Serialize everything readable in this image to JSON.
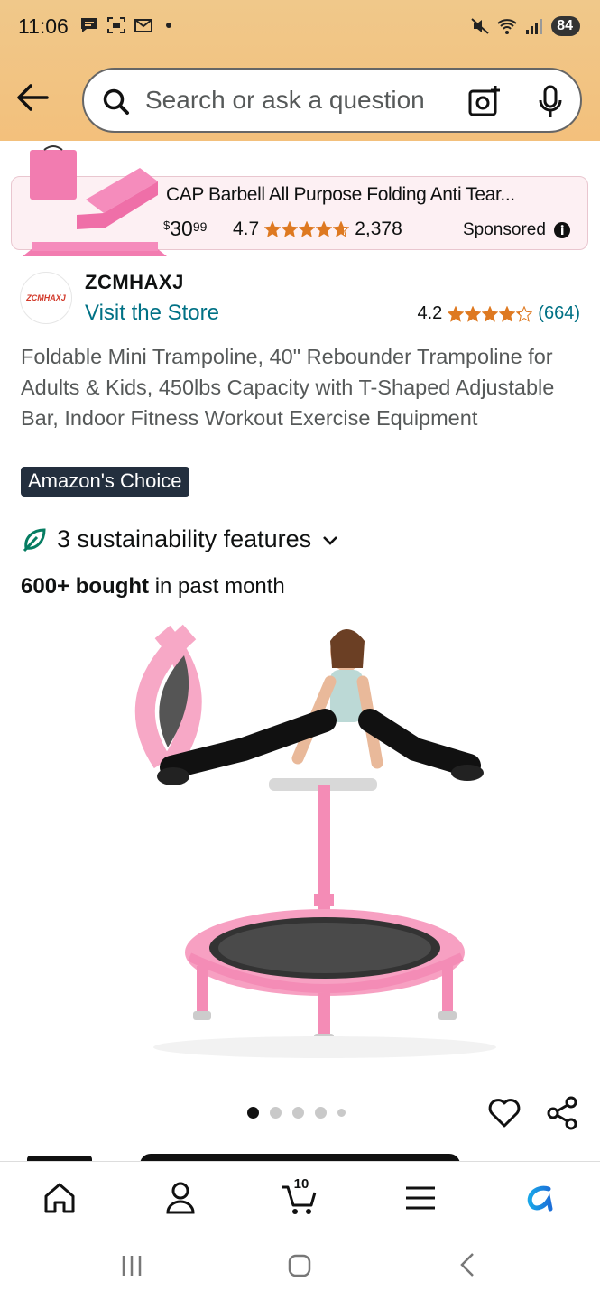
{
  "status_bar": {
    "time": "11:06",
    "battery": "84",
    "icons": [
      "message-icon",
      "screenshot-icon",
      "gmail-icon",
      "dot-icon",
      "mute-icon",
      "wifi-icon",
      "signal-icon",
      "battery-icon"
    ]
  },
  "search": {
    "placeholder": "Search or ask a question"
  },
  "sponsored_ad": {
    "title": "CAP Barbell All Purpose Folding Anti Tear...",
    "price_symbol": "$",
    "price_whole": "30",
    "price_cents": "99",
    "rating": "4.7",
    "rating_value": 4.7,
    "review_count": "2,378",
    "label": "Sponsored"
  },
  "brand": {
    "logo_text": "ZCMHAXJ",
    "name": "ZCMHAXJ",
    "visit_store": "Visit the Store",
    "rating": "4.2",
    "rating_value": 4.2,
    "review_count": "(664)"
  },
  "product": {
    "title": "Foldable Mini Trampoline, 40\" Rebounder Trampoline for Adults & Kids, 450lbs Capacity with T-Shaped Adjustable Bar, Indoor Fitness Workout Exercise Equipment",
    "badge": "Amazon's Choice",
    "sustainability": "3 sustainability features",
    "bought_bold": "600+ bought",
    "bought_rest": " in past month",
    "image_count": 5,
    "active_image": 1
  },
  "bottom_nav": {
    "items": [
      "home-icon",
      "account-icon",
      "cart-icon",
      "menu-icon",
      "rufus-icon"
    ],
    "cart_count": "10"
  },
  "colors": {
    "header_bg": "#f3c07c",
    "link": "#007185",
    "star": "#de7921",
    "badge_bg": "#232f3e",
    "pink": "#f28fb4"
  }
}
